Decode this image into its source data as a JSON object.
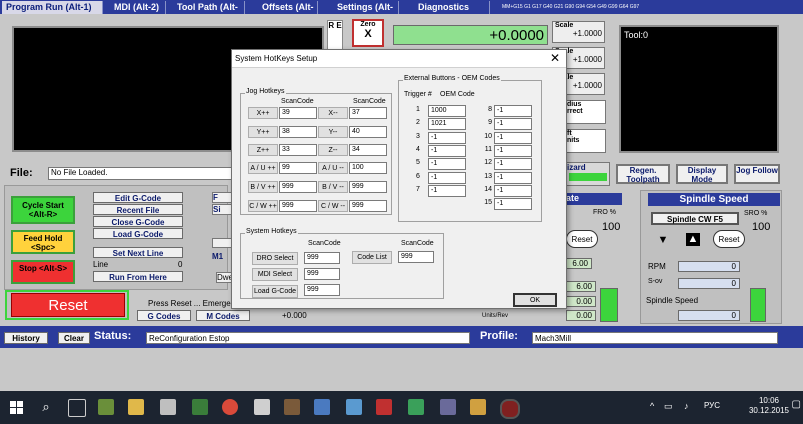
{
  "tabs": [
    {
      "label": "Program Run (Alt-1)",
      "active": true
    },
    {
      "label": "MDI (Alt-2)"
    },
    {
      "label": "Tool Path (Alt-4)"
    },
    {
      "label": "Offsets (Alt-5)"
    },
    {
      "label": "Settings (Alt-6)"
    },
    {
      "label": "Diagnostics (Alt-7)"
    }
  ],
  "gcode_ticker": "MM+G15 G1 G17 G40 G21 G90 G94 G54 G49 G99 G64 G97",
  "ref_letters": "R E",
  "zero_label": "Zero",
  "zero_axis": "X",
  "dro_value": "+0.0000",
  "scale_labels": [
    "Scale",
    "Scale",
    "Scale"
  ],
  "scale_values": [
    "+1.0000",
    "+1.0000",
    "+1.0000"
  ],
  "tool_display": "Tool:0",
  "file_label": "File:",
  "file_value": "No File Loaded.",
  "right_buttons": {
    "regen": "Regen. Toolpath",
    "display_mode": "Display Mode",
    "jog_follow": "Jog Follow"
  },
  "partial_labels": {
    "dius": "dius",
    "rect": "rrect",
    "ft": "ft",
    "nits": "nits",
    "wizard": "izard",
    "ate": "ate"
  },
  "gcode_buttons": [
    "Edit G-Code",
    "Recent File",
    "Close G-Code",
    "Load G-Code"
  ],
  "set_next_line": "Set Next Line",
  "run_from_here": "Run From Here",
  "line_label": "Line",
  "line_value": "0",
  "cycle_start": "Cycle Start <Alt-R>",
  "feed_hold": "Feed Hold <Spc>",
  "stop": "Stop <Alt-S>",
  "reset": "Reset",
  "press_reset": "Press Reset ... Emerge",
  "g_codes": "G Codes",
  "m_codes": "M Codes",
  "m_value": "+0.000",
  "partial_m1": "M1",
  "partial_dwe": "Dwe",
  "partial_f": "F",
  "partial_si": "Si",
  "fro_label": "FRO %",
  "fro_value": "100",
  "reset_small": "Reset",
  "v600": "6.00",
  "units_rev": "Units/Rev",
  "v600b": "6.00",
  "v000a": "0.00",
  "v000b": "0.00",
  "spindle_speed_title": "Spindle Speed",
  "spindle_cw": "Spindle CW F5",
  "sro_label": "SRO %",
  "sro_value": "100",
  "rpm_label": "RPM",
  "rpm_value": "0",
  "sov_label": "S-ov",
  "sov_value": "0",
  "spindle_speed_label": "Spindle Speed",
  "spindle_speed_value": "0",
  "history": "History",
  "clear": "Clear",
  "status_label": "Status:",
  "status_value": "ReConfiguration Estop",
  "profile_label": "Profile:",
  "profile_value": "Mach3Mill",
  "dialog": {
    "title": "System HotKeys Setup",
    "close": "✕",
    "jog_group": "Jog Hotkeys",
    "scancode": "ScanCode",
    "jog_rows": [
      {
        "a": "X++",
        "av": "39",
        "b": "X--",
        "bv": "37"
      },
      {
        "a": "Y++",
        "av": "38",
        "b": "Y--",
        "bv": "40"
      },
      {
        "a": "Z++",
        "av": "33",
        "b": "Z--",
        "bv": "34"
      },
      {
        "a": "A / U ++",
        "av": "99",
        "b": "A / U --",
        "bv": "100"
      },
      {
        "a": "B / V ++",
        "av": "999",
        "b": "B / V --",
        "bv": "999"
      },
      {
        "a": "C / W ++",
        "av": "999",
        "b": "C / W --",
        "bv": "999"
      }
    ],
    "sys_group": "System Hotkeys",
    "sys_rows": [
      {
        "a": "DRO Select",
        "av": "999",
        "b": "Code List",
        "bv": "999"
      },
      {
        "a": "MDI Select",
        "av": "999"
      },
      {
        "a": "Load G-Code",
        "av": "999"
      }
    ],
    "ext_group": "External Buttons - OEM Codes",
    "trigger": "Trigger  #",
    "oem_code": "OEM Code",
    "ext_left": [
      {
        "n": "1",
        "v": "1000"
      },
      {
        "n": "2",
        "v": "1021"
      },
      {
        "n": "3",
        "v": "-1"
      },
      {
        "n": "4",
        "v": "-1"
      },
      {
        "n": "5",
        "v": "-1"
      },
      {
        "n": "6",
        "v": "-1"
      },
      {
        "n": "7",
        "v": "-1"
      }
    ],
    "ext_right": [
      {
        "n": "8",
        "v": "-1"
      },
      {
        "n": "9",
        "v": "-1"
      },
      {
        "n": "10",
        "v": "-1"
      },
      {
        "n": "11",
        "v": "-1"
      },
      {
        "n": "12",
        "v": "-1"
      },
      {
        "n": "13",
        "v": "-1"
      },
      {
        "n": "14",
        "v": "-1"
      },
      {
        "n": "15",
        "v": "-1"
      }
    ],
    "ok": "OK"
  },
  "taskbar": {
    "time": "10:06",
    "date": "30.12.2015",
    "lang": "РУС"
  }
}
